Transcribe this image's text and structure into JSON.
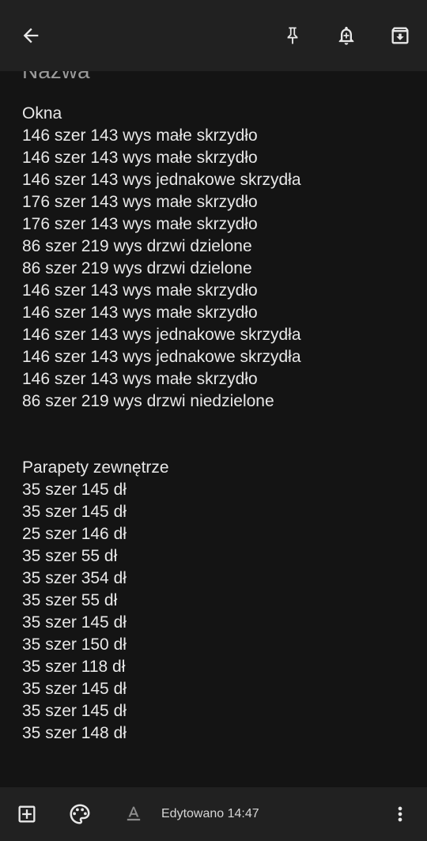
{
  "header": {
    "back_icon": "arrow-back-icon",
    "pin_icon": "pin-icon",
    "reminder_icon": "bell-plus-icon",
    "archive_icon": "archive-icon"
  },
  "note": {
    "title": "Nazwa",
    "lines": [
      "Okna",
      "146 szer 143 wys małe skrzydło",
      "146 szer 143 wys małe skrzydło",
      "146 szer 143 wys jednakowe skrzydła",
      "176 szer 143 wys małe skrzydło",
      "176 szer 143 wys małe skrzydło",
      "86 szer 219 wys drzwi dzielone",
      "86 szer 219 wys drzwi dzielone",
      "146 szer 143 wys małe skrzydło",
      "146 szer 143 wys małe skrzydło",
      "146 szer 143 wys jednakowe skrzydła",
      "146 szer 143 wys jednakowe skrzydła",
      "146 szer 143 wys małe skrzydło",
      "86 szer 219 wys drzwi niedzielone",
      "",
      "",
      "Parapety zewnętrze",
      "35 szer 145 dł",
      "35 szer 145 dł",
      "25 szer 146 dł",
      "35 szer 55 dł",
      "35 szer 354 dł",
      "35 szer 55 dł",
      "35 szer 145 dł",
      "35 szer 150 dł",
      "35 szer 118 dł",
      "35 szer 145 dł",
      "35 szer 145 dł",
      "35 szer 148 dł"
    ]
  },
  "footer": {
    "add_icon": "add-box-icon",
    "palette_icon": "palette-icon",
    "format_icon": "text-format-icon",
    "edited_label": "Edytowano 14:47",
    "more_icon": "more-vert-icon"
  },
  "colors": {
    "background": "#141414",
    "bar": "#212121",
    "text": "#e8e8e8",
    "title_hint": "#9a9a9a"
  }
}
